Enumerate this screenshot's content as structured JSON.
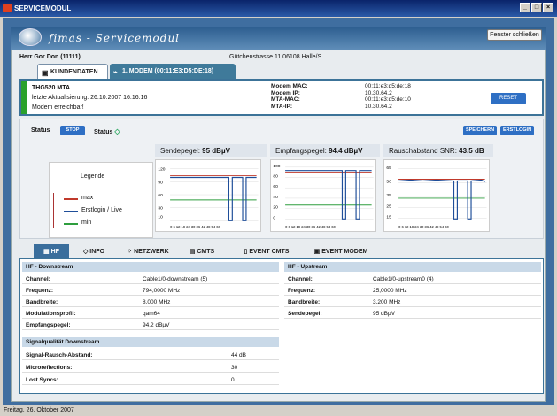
{
  "window": {
    "title": "SERVICEMODUL"
  },
  "header": {
    "logo_text": "fimas - Servicemodul",
    "close_label": "Fenster schließen"
  },
  "customer": {
    "name": "Herr Gor Don (11111)",
    "address": "Gütchenstrasse 11 06108 Halle/S."
  },
  "tabs": [
    {
      "label": "KUNDENDATEN"
    },
    {
      "label": "1. MODEM (00:11:E3:D5:DE:18)"
    }
  ],
  "modem": {
    "model": "THG520 MTA",
    "last_update": "letzte Aktualisierung: 26.10.2007 16:16:16",
    "state": "Modem erreichbar!",
    "fields": [
      {
        "label": "Modem MAC:",
        "value": "00:11:e3:d5:de:18"
      },
      {
        "label": "Modem IP:",
        "value": "10.30.64.2"
      },
      {
        "label": "MTA-MAC:",
        "value": "00:11:e3:d5:de:10"
      },
      {
        "label": "MTA-IP:",
        "value": "10.30.64.2"
      }
    ],
    "reset_label": "RESET"
  },
  "status": {
    "label": "Status",
    "stop_label": "STOP",
    "status2_label": "Status",
    "save_label": "SPEICHERN",
    "first_login_label": "ERSTLOGIN"
  },
  "legend": {
    "title": "Legende",
    "items": [
      {
        "label": "max",
        "color": "#c0392b"
      },
      {
        "label": "Erstlogin / Live",
        "color": "#1f4e99"
      },
      {
        "label": "min",
        "color": "#2e9e3e"
      }
    ]
  },
  "charts": [
    {
      "title_prefix": "Sendepegel:",
      "title_value": "95 dBµV",
      "y_ticks": [
        "120",
        "90",
        "60",
        "30",
        "10"
      ],
      "x_ticks": "0 6 12 18 24 30 36 42 48 54 60"
    },
    {
      "title_prefix": "Empfangspegel:",
      "title_value": "94.4 dBµV",
      "y_ticks": [
        "100",
        "80",
        "60",
        "40",
        "20",
        "0"
      ],
      "x_ticks": "0 6 12 18 24 30 36 42 48 54 60"
    },
    {
      "title_prefix": "Rauschabstand SNR:",
      "title_value": "43.5 dB",
      "y_ticks": [
        "65",
        "50",
        "35",
        "25",
        "15"
      ],
      "x_ticks": "0 6 12 18 24 30 36 42 48 54 60"
    }
  ],
  "nav": [
    {
      "label": "HF"
    },
    {
      "label": "INFO"
    },
    {
      "label": "NETZWERK"
    },
    {
      "label": "CMTS"
    },
    {
      "label": "EVENT CMTS"
    },
    {
      "label": "EVENT MODEM"
    }
  ],
  "downstream": {
    "title": "HF - Downstream",
    "rows": [
      {
        "k": "Channel:",
        "v": "Cable1/0-downstream (5)"
      },
      {
        "k": "Frequenz:",
        "v": "794,0000 MHz"
      },
      {
        "k": "Bandbreite:",
        "v": "8,000 MHz"
      },
      {
        "k": "Modulationsprofil:",
        "v": "qam64"
      },
      {
        "k": "Empfangspegel:",
        "v": "94,2 dBµV"
      }
    ]
  },
  "quality": {
    "title": "Signalqualität Downstream",
    "rows": [
      {
        "k": "Signal-Rausch-Abstand:",
        "v": "44 dB"
      },
      {
        "k": "Microreflections:",
        "v": "30"
      },
      {
        "k": "Lost Syncs:",
        "v": "0"
      }
    ]
  },
  "upstream": {
    "title": "HF - Upstream",
    "rows": [
      {
        "k": "Channel:",
        "v": "Cable1/0-upstream0 (4)"
      },
      {
        "k": "Frequenz:",
        "v": "25,0000 MHz"
      },
      {
        "k": "Bandbreite:",
        "v": "3,200 MHz"
      },
      {
        "k": "Sendepegel:",
        "v": "95 dBµV"
      }
    ]
  },
  "footer": {
    "date": "Freitag, 26. Oktober 2007"
  }
}
